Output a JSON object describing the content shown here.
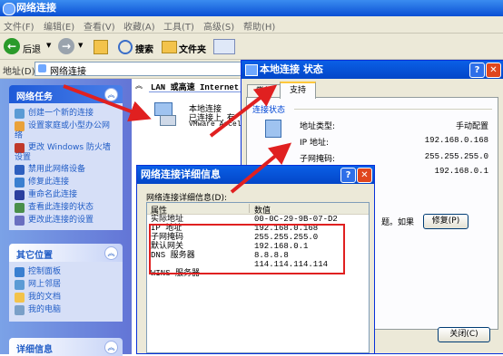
{
  "main_window": {
    "title": "网络连接",
    "menus": [
      "文件(F)",
      "编辑(E)",
      "查看(V)",
      "收藏(A)",
      "工具(T)",
      "高级(S)",
      "帮助(H)"
    ],
    "toolbar": {
      "back": "后退",
      "search": "搜索",
      "folders": "文件夹"
    },
    "address": {
      "label": "地址(D)",
      "value": "网络连接"
    }
  },
  "task_panes": {
    "network_tasks": {
      "title": "网络任务",
      "items": [
        "创建一个新的连接",
        "设置家庭或小型办公网络",
        "更改 Windows 防火墙设置",
        "禁用此网络设备",
        "修复此连接",
        "重命名此连接",
        "查看此连接的状态",
        "更改此连接的设置"
      ]
    },
    "other_places": {
      "title": "其它位置",
      "items": [
        "控制面板",
        "网上邻居",
        "我的文档",
        "我的电脑"
      ]
    },
    "details": {
      "title": "详细信息"
    }
  },
  "content": {
    "group_header": "LAN 或高速 Internet",
    "connection": {
      "name": "本地连接",
      "status": "已连接上, 有",
      "device": "VMware Accel"
    }
  },
  "status_dialog": {
    "title": "本地连接 状态",
    "tabs": [
      "常规",
      "支持"
    ],
    "section": "连接状态",
    "rows": [
      {
        "label": "地址类型:",
        "value": "手动配置"
      },
      {
        "label": "IP 地址:",
        "value": "192.168.0.168"
      },
      {
        "label": "子网掩码:",
        "value": "255.255.255.0"
      },
      {
        "label": "",
        "value": "192.168.0.1"
      }
    ],
    "note": "题。如果",
    "repair_button": "修复(P)",
    "close_button": "关闭(C)"
  },
  "details_dialog": {
    "title": "网络连接详细信息",
    "label": "网络连接详细信息(D):",
    "columns": [
      "属性",
      "数值"
    ],
    "rows": [
      {
        "prop": "实际地址",
        "value": "00-0C-29-9B-07-D2"
      },
      {
        "prop": "IP 地址",
        "value": "192.168.0.168"
      },
      {
        "prop": "子网掩码",
        "value": "255.255.255.0"
      },
      {
        "prop": "默认网关",
        "value": "192.168.0.1"
      },
      {
        "prop": "DNS 服务器",
        "value": "8.8.8.8"
      },
      {
        "prop": "",
        "value": "114.114.114.114"
      },
      {
        "prop": "WINS 服务器",
        "value": ""
      }
    ]
  },
  "colors": {
    "annotation_red": "#e02020",
    "title_blue": "#0a5fe6",
    "dialog_bg": "#ece9d8"
  }
}
